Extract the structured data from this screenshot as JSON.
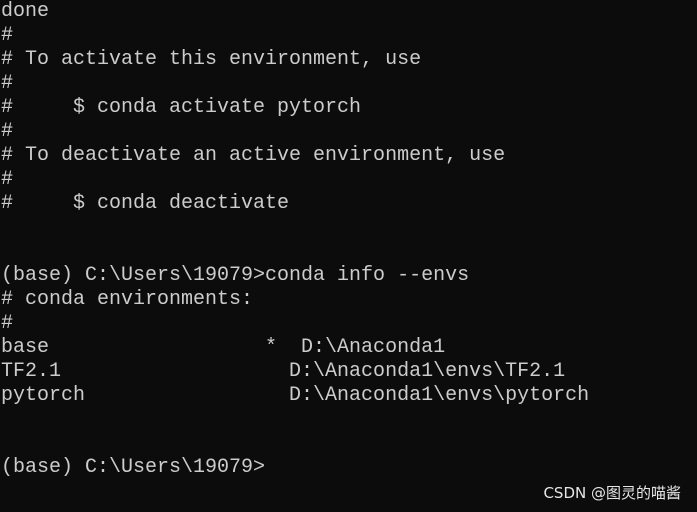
{
  "terminal": {
    "lines": [
      "done",
      "#",
      "# To activate this environment, use",
      "#",
      "#     $ conda activate pytorch",
      "#",
      "# To deactivate an active environment, use",
      "#",
      "#     $ conda deactivate",
      "",
      "",
      "(base) C:\\Users\\19079>conda info --envs",
      "# conda environments:",
      "#",
      "base                  *  D:\\Anaconda1",
      "TF2.1                   D:\\Anaconda1\\envs\\TF2.1",
      "pytorch                 D:\\Anaconda1\\envs\\pytorch",
      "",
      "",
      "(base) C:\\Users\\19079>"
    ]
  },
  "watermark": "CSDN @图灵的喵酱",
  "colors": {
    "background": "#0c0c0c",
    "text": "#cccccc"
  }
}
